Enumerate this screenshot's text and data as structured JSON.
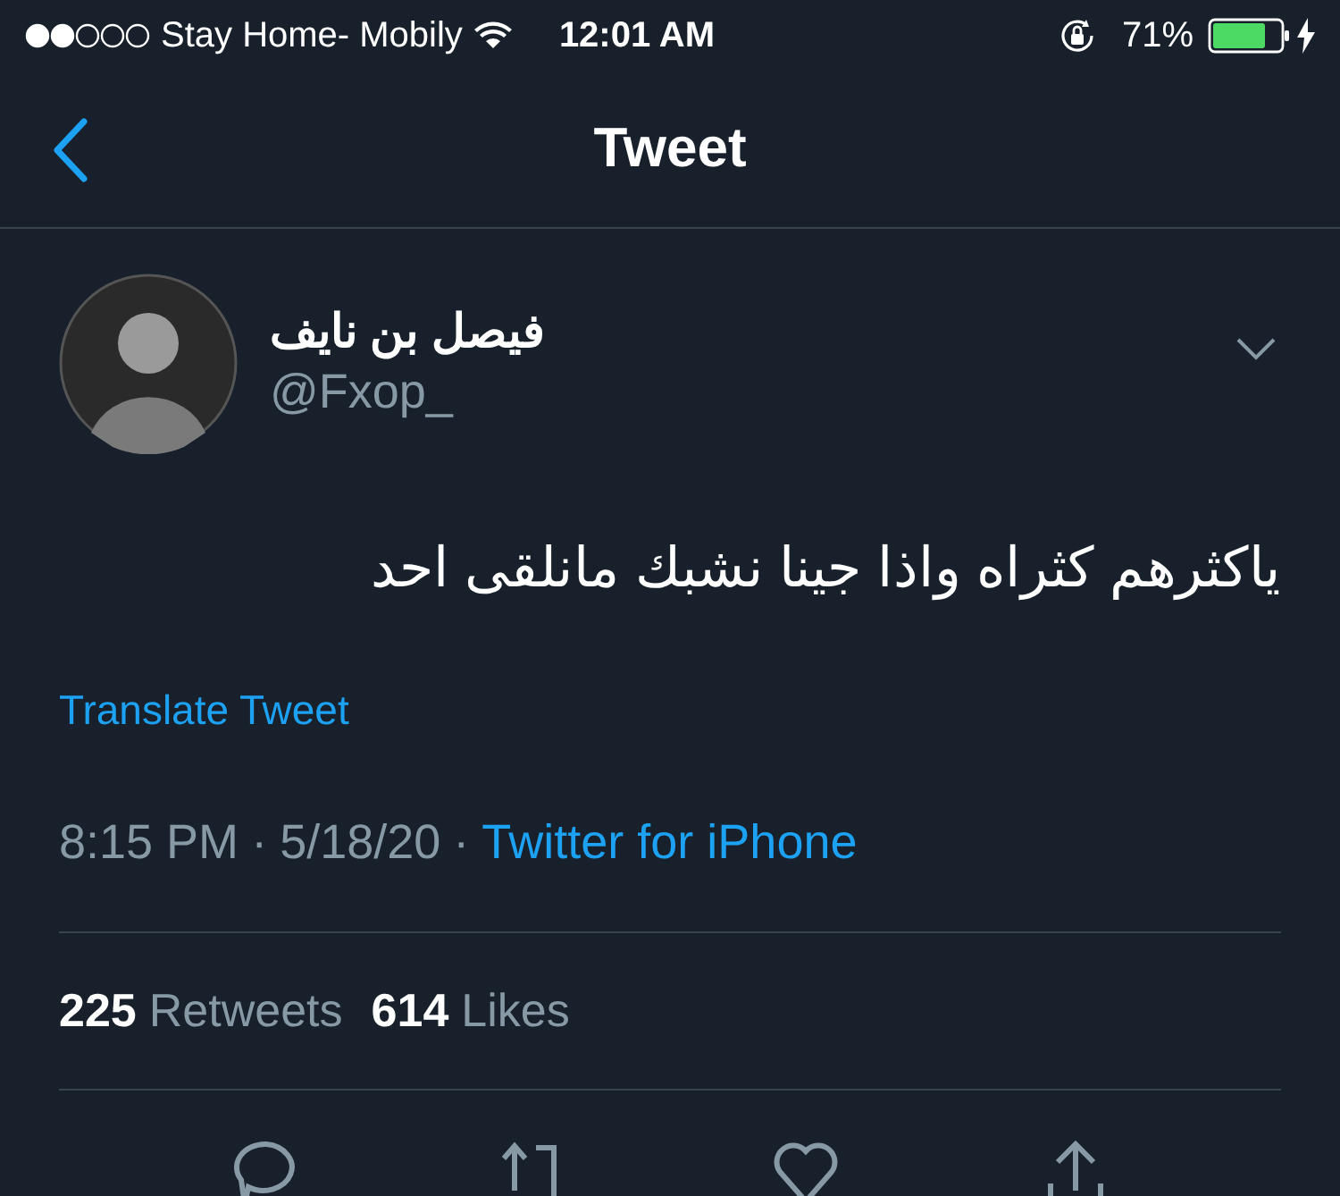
{
  "status_bar": {
    "carrier": "Stay Home- Mobily",
    "time": "12:01 AM",
    "battery": "71%"
  },
  "nav": {
    "title": "Tweet"
  },
  "tweet": {
    "name": "فيصل بن نايف",
    "handle": "@Fxop_",
    "text": "ياكثرهم كثراه واذا جينا نشبك مانلقى احد",
    "translate": "Translate Tweet",
    "time": "8:15 PM",
    "separator_1": "·",
    "date": "5/18/20",
    "separator_2": "·",
    "source": "Twitter for iPhone"
  },
  "stats": [
    {
      "count": "225",
      "label": "Retweets"
    },
    {
      "count": "614",
      "label": "Likes"
    }
  ]
}
